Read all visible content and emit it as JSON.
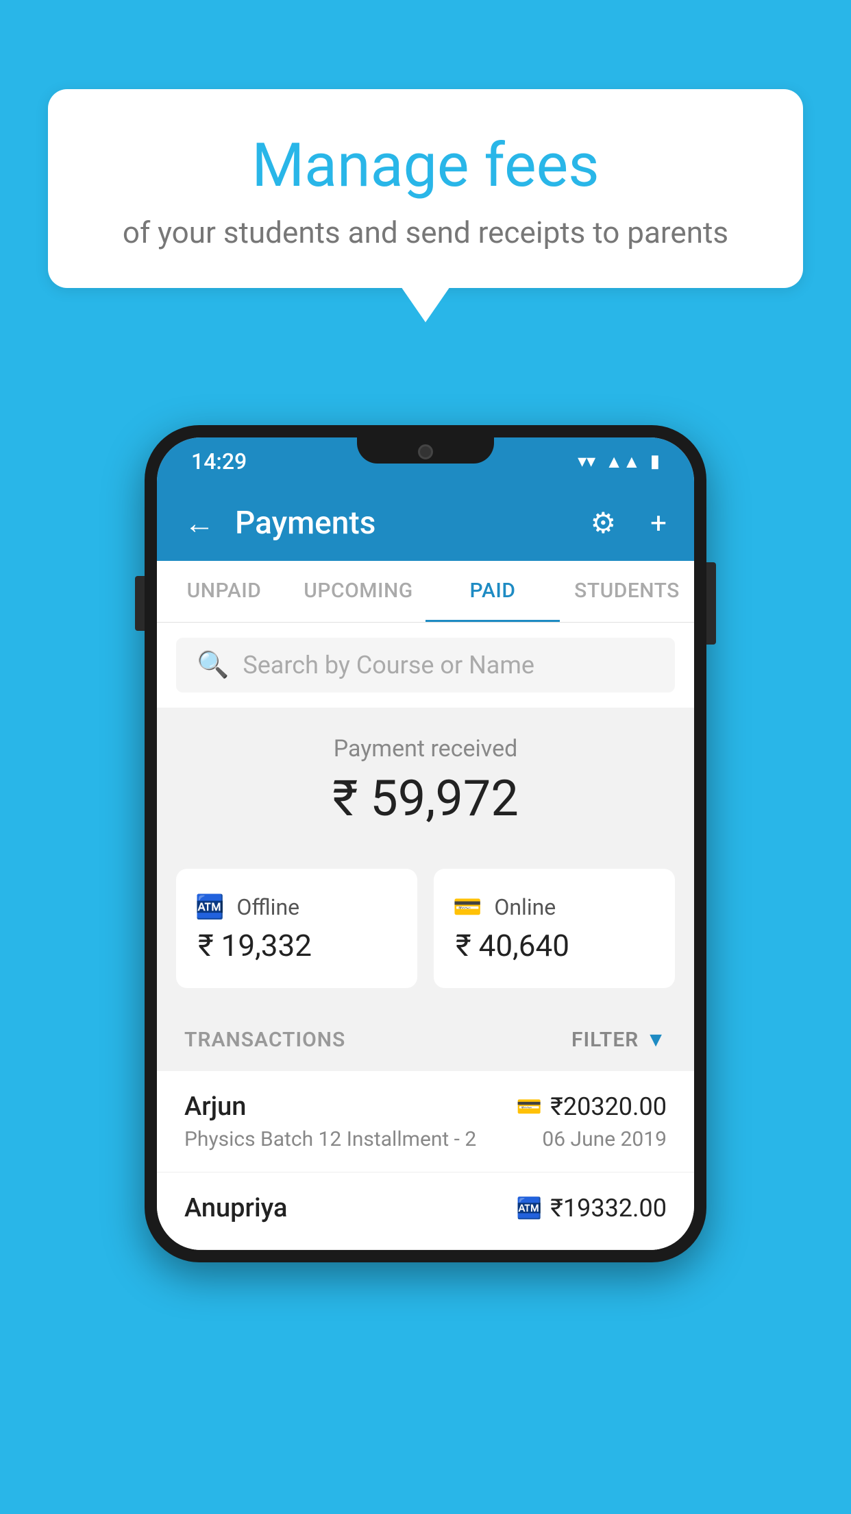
{
  "page": {
    "bg_color": "#29b6e8"
  },
  "speech_bubble": {
    "heading": "Manage fees",
    "subtext": "of your students and send receipts to parents"
  },
  "status_bar": {
    "time": "14:29"
  },
  "app_bar": {
    "title": "Payments",
    "back_label": "←",
    "gear_label": "⚙",
    "plus_label": "+"
  },
  "tabs": [
    {
      "label": "UNPAID",
      "active": false
    },
    {
      "label": "UPCOMING",
      "active": false
    },
    {
      "label": "PAID",
      "active": true
    },
    {
      "label": "STUDENTS",
      "active": false
    }
  ],
  "search": {
    "placeholder": "Search by Course or Name"
  },
  "payment_summary": {
    "label": "Payment received",
    "amount": "₹ 59,972",
    "offline_label": "Offline",
    "offline_amount": "₹ 19,332",
    "online_label": "Online",
    "online_amount": "₹ 40,640"
  },
  "transactions": {
    "header": "TRANSACTIONS",
    "filter": "FILTER",
    "rows": [
      {
        "name": "Arjun",
        "amount": "₹20320.00",
        "course": "Physics Batch 12 Installment - 2",
        "date": "06 June 2019",
        "pay_type": "card"
      },
      {
        "name": "Anupriya",
        "amount": "₹19332.00",
        "course": "",
        "date": "",
        "pay_type": "cash"
      }
    ]
  }
}
